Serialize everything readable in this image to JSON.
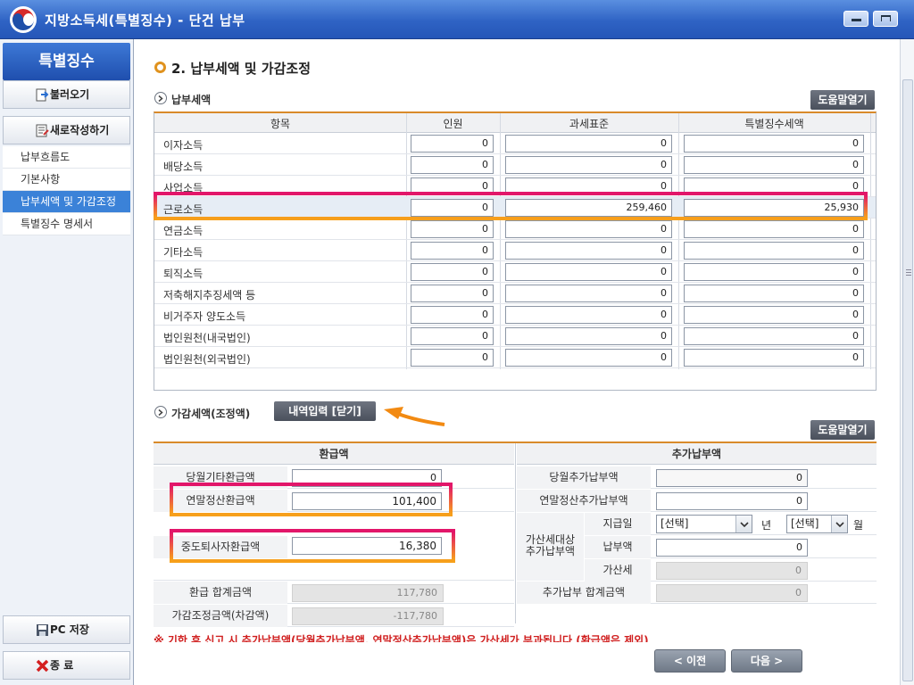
{
  "window": {
    "title": "지방소득세(특별징수) - 단건 납부"
  },
  "sidebar": {
    "header": "특별징수",
    "load_button": "불러오기",
    "new_button": "새로작성하기",
    "menu": [
      "납부흐름도",
      "기본사항",
      "납부세액 및 가감조정",
      "특별징수 명세서"
    ],
    "active_index": 2,
    "pc_save_button": "PC 저장",
    "exit_button": "종 료"
  },
  "main": {
    "section_title": "2. 납부세액 및 가감조정",
    "tax": {
      "subtitle": "납부세액",
      "help_button": "도움말열기",
      "columns": [
        "항목",
        "인원",
        "과세표준",
        "특별징수세액"
      ],
      "rows": [
        {
          "label": "이자소득",
          "people": "0",
          "base": "0",
          "tax": "0"
        },
        {
          "label": "배당소득",
          "people": "0",
          "base": "0",
          "tax": "0"
        },
        {
          "label": "사업소득",
          "people": "0",
          "base": "0",
          "tax": "0"
        },
        {
          "label": "근로소득",
          "people": "0",
          "base": "259,460",
          "tax": "25,930"
        },
        {
          "label": "연금소득",
          "people": "0",
          "base": "0",
          "tax": "0"
        },
        {
          "label": "기타소득",
          "people": "0",
          "base": "0",
          "tax": "0"
        },
        {
          "label": "퇴직소득",
          "people": "0",
          "base": "0",
          "tax": "0"
        },
        {
          "label": "저축해지추징세액 등",
          "people": "0",
          "base": "0",
          "tax": "0"
        },
        {
          "label": "비거주자 양도소득",
          "people": "0",
          "base": "0",
          "tax": "0"
        },
        {
          "label": "법인원천(내국법인)",
          "people": "0",
          "base": "0",
          "tax": "0"
        },
        {
          "label": "법인원천(외국법인)",
          "people": "0",
          "base": "0",
          "tax": "0"
        }
      ]
    },
    "adjust": {
      "subtitle": "가감세액(조정액)",
      "detail_button": "내역입력 [닫기]",
      "help_button": "도움말열기",
      "refund_header": "환급액",
      "additional_header": "추가납부액",
      "monthly_refund_label": "당월기타환급액",
      "monthly_refund_value": "0",
      "yearend_refund_label": "연말정산환급액",
      "yearend_refund_value": "101,400",
      "midterm_refund_label": "중도퇴사자환급액",
      "midterm_refund_value": "16,380",
      "refund_total_label": "환급 합계금액",
      "refund_total_value": "117,780",
      "adjust_total_label": "가감조정금액(차감액)",
      "adjust_total_value": "-117,780",
      "monthly_add_label": "당월추가납부액",
      "monthly_add_value": "0",
      "yearend_add_label": "연말정산추가납부액",
      "yearend_add_value": "0",
      "penalty_group_label": "가산세대상\n추가납부액",
      "due_date_label": "지급일",
      "year_select": "[선택]",
      "year_unit": "년",
      "month_select": "[선택]",
      "month_unit": "월",
      "pay_amount_label": "납부액",
      "pay_amount_value": "0",
      "penalty_label": "가산세",
      "penalty_value": "0",
      "add_total_label": "추가납부 합계금액",
      "add_total_value": "0"
    },
    "warning": "※ 기한 후 신고 시 추가납부액(당월추가납부액, 연말정산추가납부액)은 가산세가 부과됩니다 (환급액은 제외)"
  },
  "footer": {
    "prev_button": "< 이전",
    "next_button": "다음 >"
  },
  "colors": {
    "accent_orange": "#d98a2a",
    "highlight_pink": "#e2146b",
    "sidebar_active": "#3b82d8",
    "title_blue": "#2f63c4"
  }
}
